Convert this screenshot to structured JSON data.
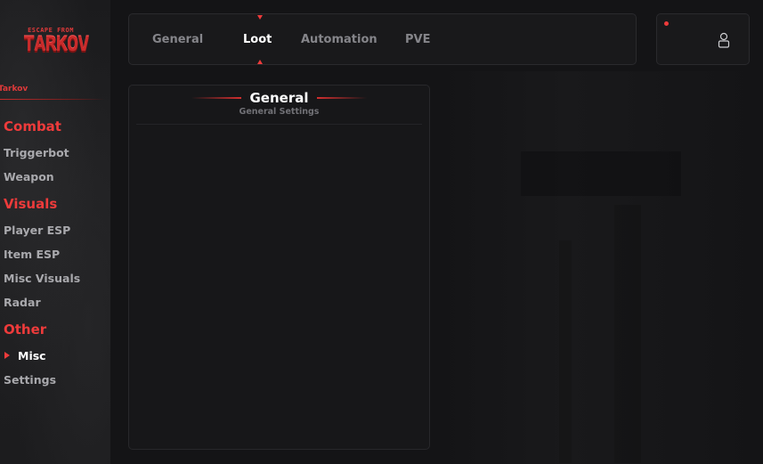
{
  "sidebar": {
    "logo": {
      "line1": "ESCAPE FROM",
      "line2": "TARKOV"
    },
    "game_label": "Tarkov",
    "categories": [
      {
        "label": "Combat",
        "items": [
          {
            "label": "Triggerbot"
          },
          {
            "label": "Weapon"
          }
        ]
      },
      {
        "label": "Visuals",
        "items": [
          {
            "label": "Player ESP"
          },
          {
            "label": "Item ESP"
          },
          {
            "label": "Misc Visuals"
          },
          {
            "label": "Radar"
          }
        ]
      },
      {
        "label": "Other",
        "items": [
          {
            "label": "Misc",
            "active": true
          },
          {
            "label": "Settings"
          }
        ]
      }
    ]
  },
  "tabs": [
    {
      "label": "General"
    },
    {
      "label": "Loot",
      "active": true
    },
    {
      "label": "Automation"
    },
    {
      "label": "PVE"
    }
  ],
  "profile": {
    "icon": "user-icon",
    "status_color": "#ee3b3b"
  },
  "panel": {
    "title": "General",
    "subtitle": "General Settings"
  },
  "colors": {
    "accent": "#ee3b3b",
    "bg": "#141416",
    "panel": "#171719"
  }
}
